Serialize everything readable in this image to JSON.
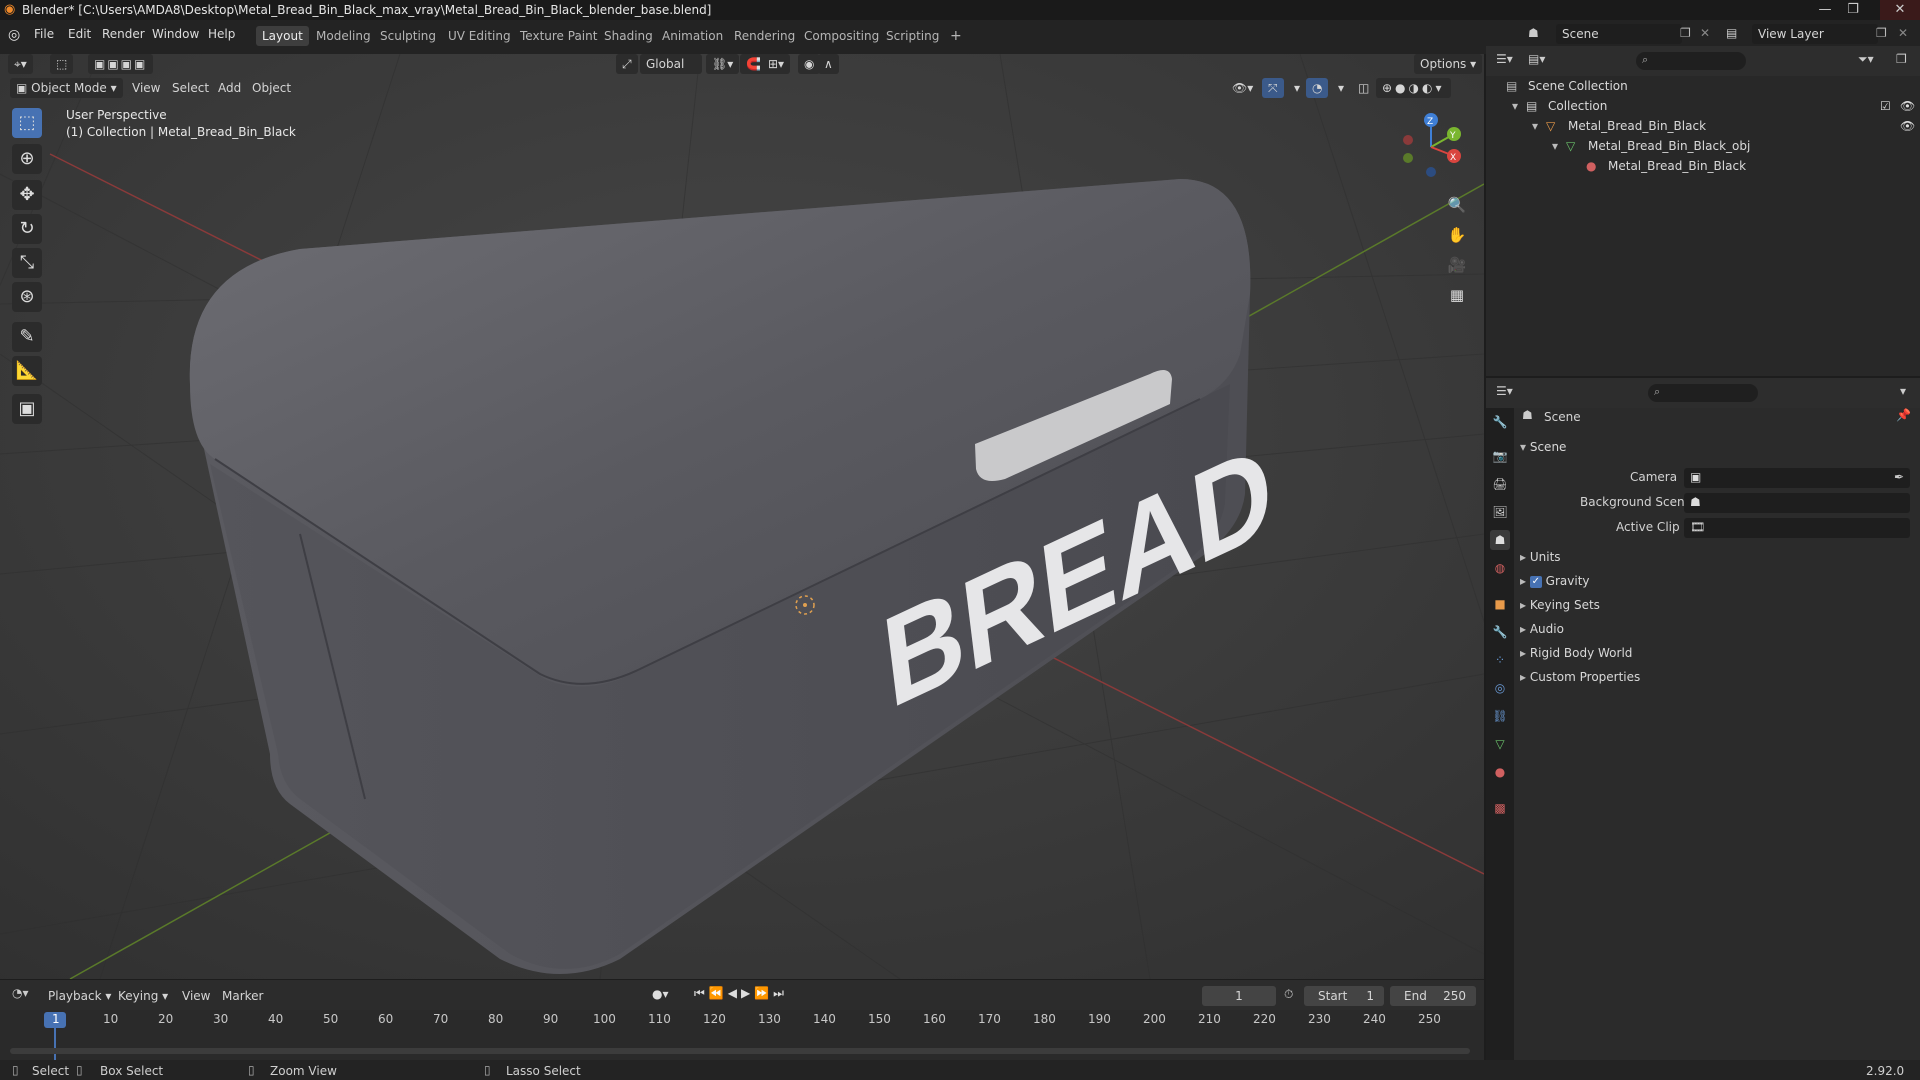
{
  "window": {
    "title": "Blender* [C:\\Users\\AMDA8\\Desktop\\Metal_Bread_Bin_Black_max_vray\\Metal_Bread_Bin_Black_blender_base.blend]",
    "controls": [
      "—",
      "❐",
      "✕"
    ]
  },
  "menu": [
    "File",
    "Edit",
    "Render",
    "Window",
    "Help"
  ],
  "workspaces": [
    "Layout",
    "Modeling",
    "Sculpting",
    "UV Editing",
    "Texture Paint",
    "Shading",
    "Animation",
    "Rendering",
    "Compositing",
    "Scripting"
  ],
  "workspace_add": "+",
  "scene_selector": "Scene",
  "view_layer": "View Layer",
  "viewport": {
    "transform_orientation": "Global",
    "options_label": "Options",
    "mode": "Object Mode",
    "menus": [
      "View",
      "Select",
      "Add",
      "Object"
    ],
    "overlay_title": "User Perspective",
    "overlay_subtitle": "(1) Collection | Metal_Bread_Bin_Black",
    "object_text": "BREAD",
    "gizmo_axes": {
      "x": "X",
      "y": "Y",
      "z": "Z"
    }
  },
  "outliner": {
    "rows": [
      {
        "label": "Scene Collection"
      },
      {
        "label": "Collection"
      },
      {
        "label": "Metal_Bread_Bin_Black"
      },
      {
        "label": "Metal_Bread_Bin_Black_obj"
      },
      {
        "label": "Metal_Bread_Bin_Black"
      }
    ]
  },
  "properties": {
    "context": "Scene",
    "section": "Scene",
    "fields": [
      {
        "label": "Camera"
      },
      {
        "label": "Background Scene"
      },
      {
        "label": "Active Clip"
      }
    ],
    "panels": [
      "Units",
      "Gravity",
      "Keying Sets",
      "Audio",
      "Rigid Body World",
      "Custom Properties"
    ],
    "gravity_checked": true
  },
  "timeline": {
    "menus": [
      "Playback",
      "Keying",
      "View",
      "Marker"
    ],
    "current_frame": "1",
    "start_label": "Start",
    "start_value": "1",
    "end_label": "End",
    "end_value": "250",
    "ruler": [
      "1",
      "10",
      "20",
      "30",
      "40",
      "50",
      "60",
      "70",
      "80",
      "90",
      "100",
      "110",
      "120",
      "130",
      "140",
      "150",
      "160",
      "170",
      "180",
      "190",
      "200",
      "210",
      "220",
      "230",
      "240",
      "250"
    ]
  },
  "status": {
    "select": "Select",
    "box_select": "Box Select",
    "zoom_view": "Zoom View",
    "lasso_select": "Lasso Select",
    "version": "2.92.0"
  },
  "colors": {
    "accent": "#4772b3",
    "axis_x": "#d9453f",
    "axis_y": "#7ab62f",
    "axis_z": "#3f7fd6"
  }
}
